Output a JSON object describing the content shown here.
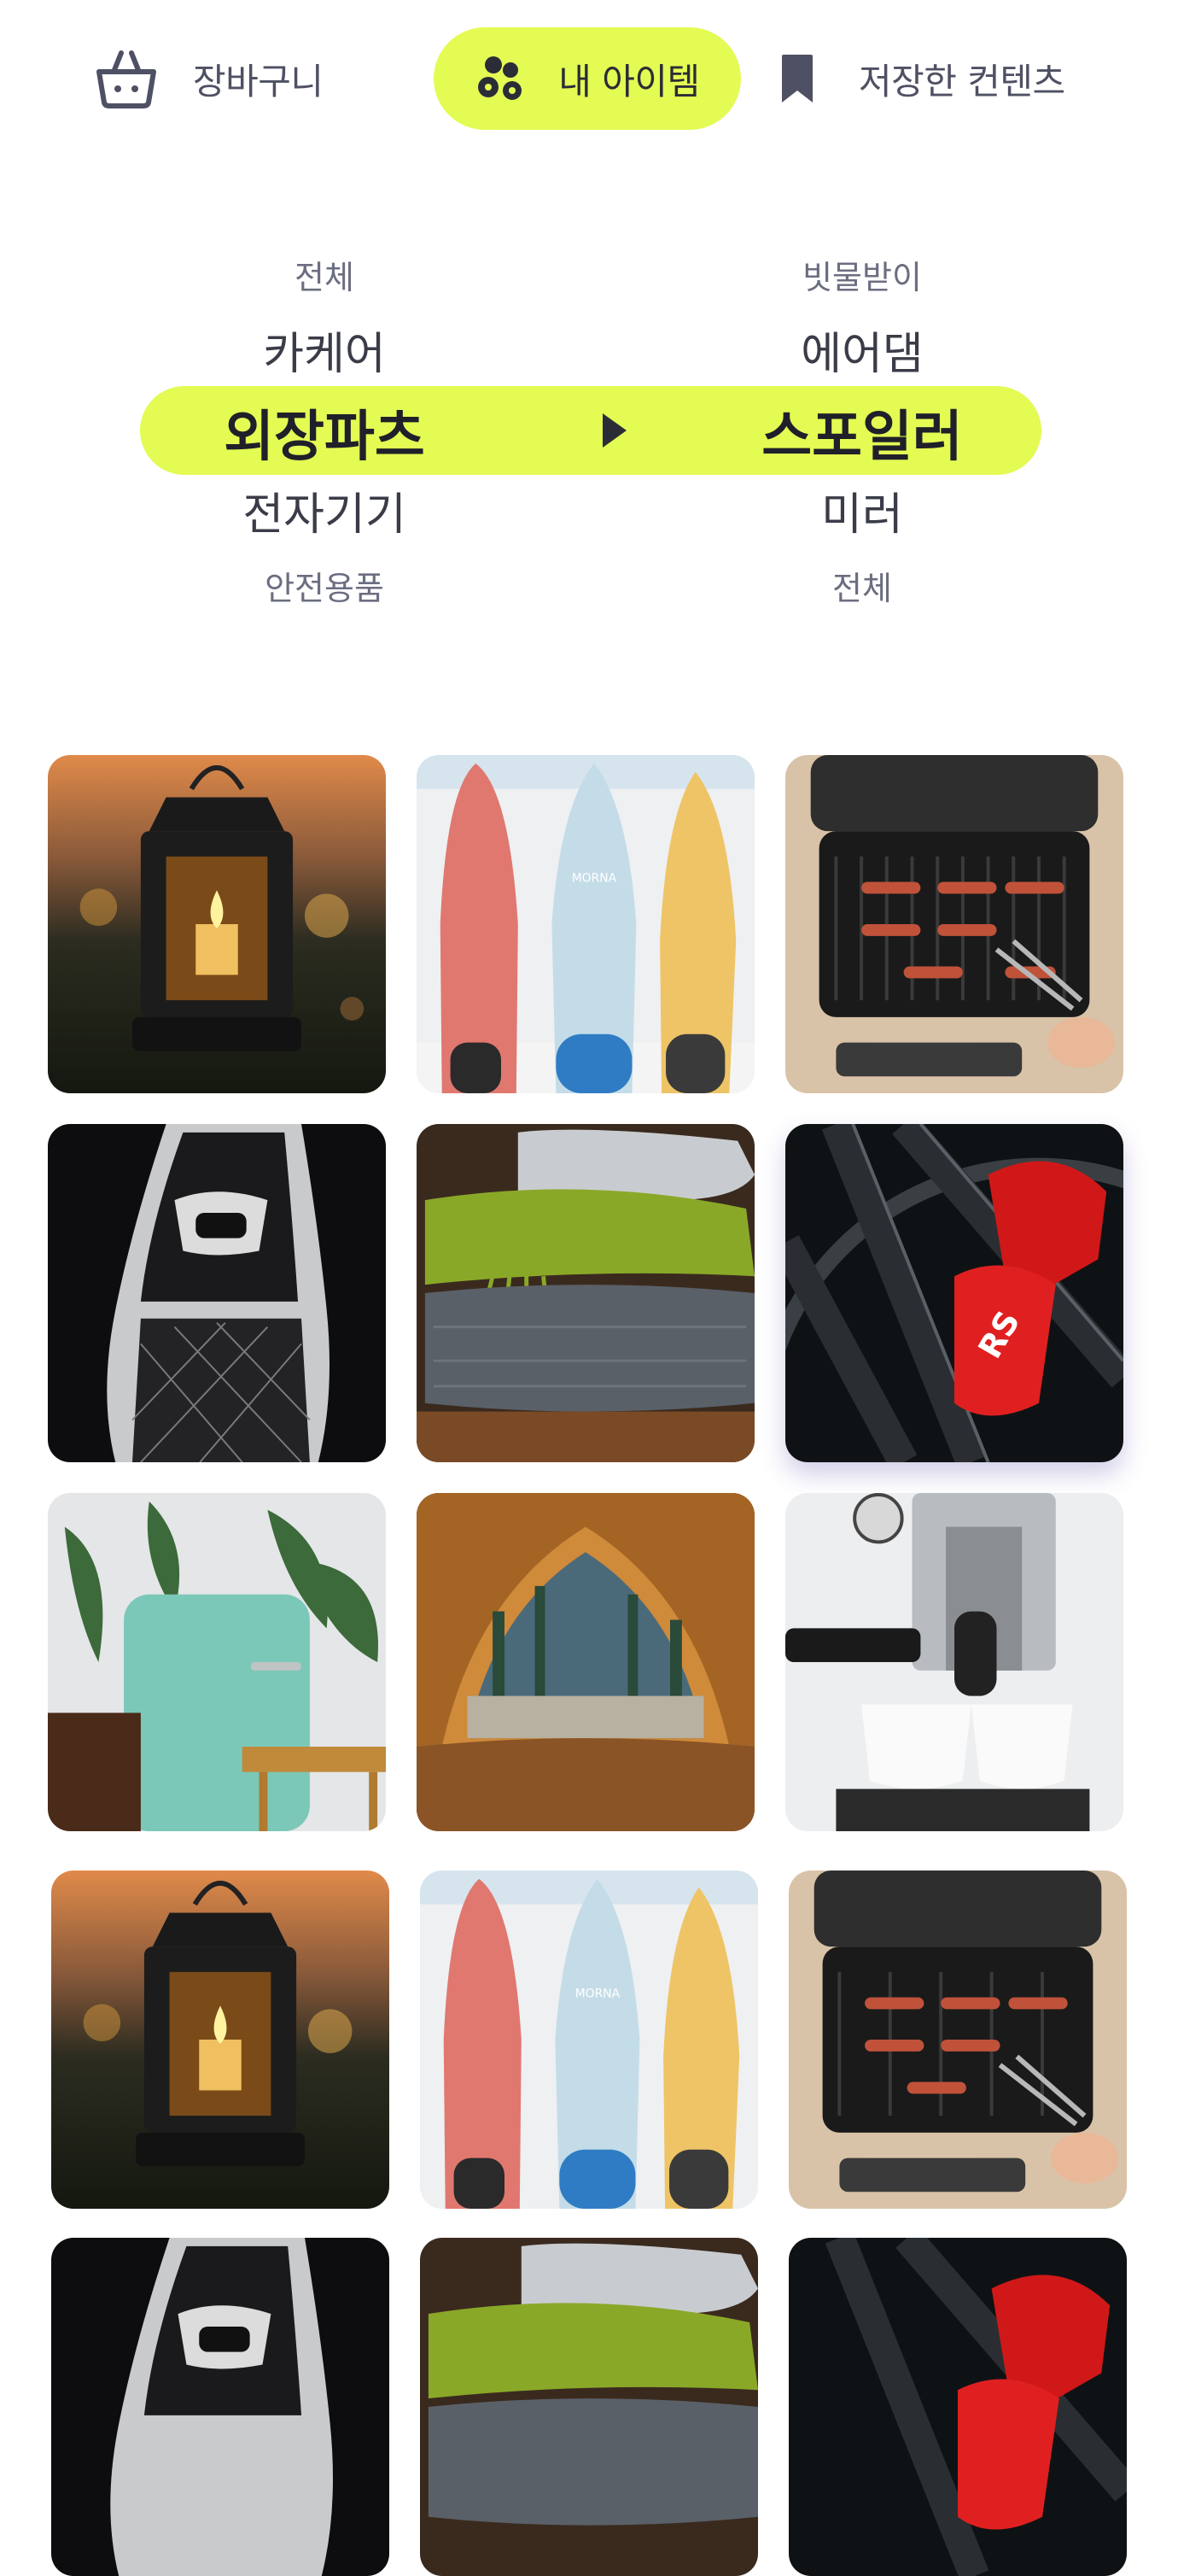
{
  "tabs": [
    {
      "id": "cart",
      "label": "장바구니",
      "icon": "shopping-basket-icon",
      "active": false
    },
    {
      "id": "my-items",
      "label": "내 아이템",
      "icon": "my-items-icon",
      "active": true
    },
    {
      "id": "saved",
      "label": "저장한 컨텐츠",
      "icon": "bookmark-icon",
      "active": false
    }
  ],
  "picker": {
    "category": {
      "options": [
        "전체",
        "카케어",
        "외장파츠",
        "전자기기",
        "안전용품"
      ],
      "selected": "외장파츠"
    },
    "subcategory": {
      "options": [
        "빗물받이",
        "에어댐",
        "스포일러",
        "미러",
        "전체"
      ],
      "selected": "스포일러"
    },
    "arrow_icon": "triangle-right-icon"
  },
  "grid": {
    "items": [
      {
        "subject": "lantern"
      },
      {
        "subject": "surfboards"
      },
      {
        "subject": "grill"
      },
      {
        "subject": "car-seat"
      },
      {
        "subject": "blankets"
      },
      {
        "subject": "brake-caliper"
      },
      {
        "subject": "retro-fridge"
      },
      {
        "subject": "tent"
      },
      {
        "subject": "espresso-machine"
      },
      {
        "subject": "lantern"
      },
      {
        "subject": "surfboards"
      },
      {
        "subject": "grill"
      },
      {
        "subject": "car-seat"
      },
      {
        "subject": "blankets"
      },
      {
        "subject": "brake-caliper"
      }
    ]
  },
  "colors": {
    "accent": "#e4fb54",
    "text_primary": "#2b2d36",
    "text_muted": "#4e5063",
    "background": "#ffffff"
  }
}
